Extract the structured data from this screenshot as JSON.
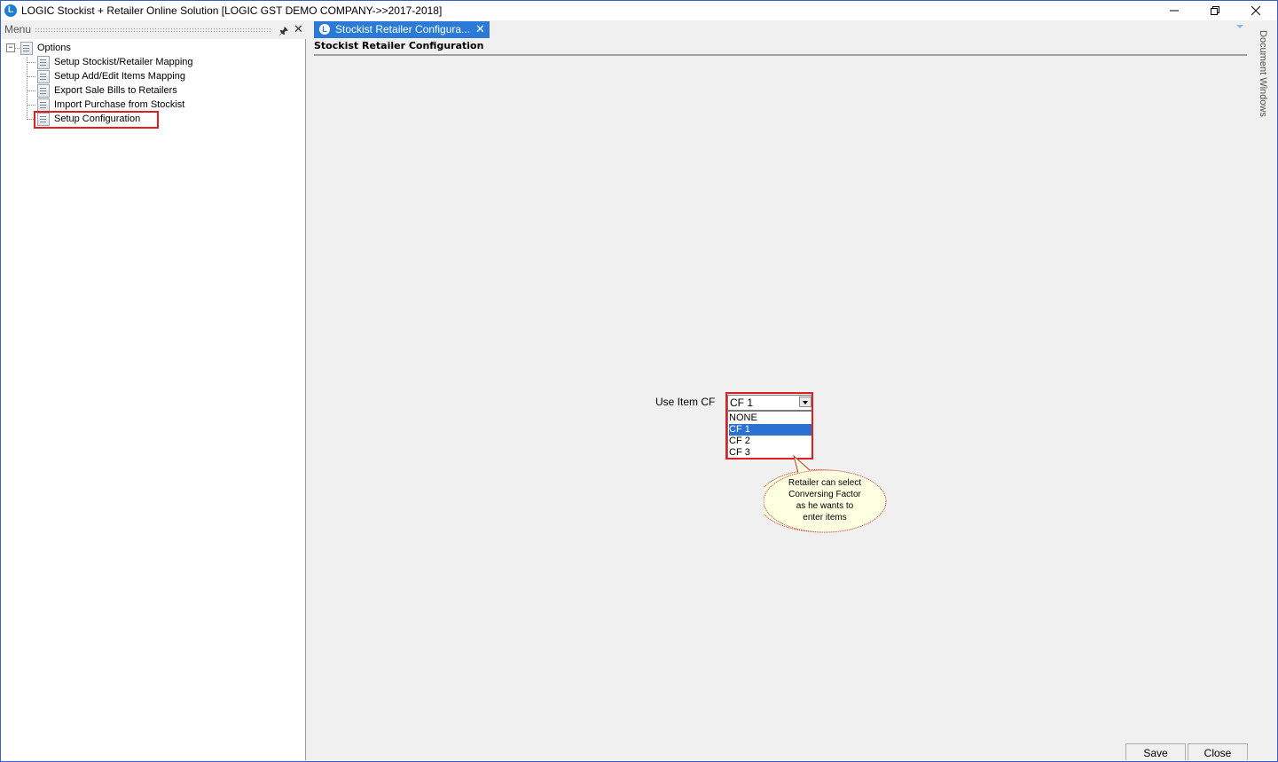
{
  "window": {
    "title": "LOGIC Stockist + Retailer Online Solution [LOGIC GST DEMO COMPANY->>2017-2018]",
    "app_icon_letter": "L"
  },
  "menu": {
    "title": "Menu",
    "root": "Options",
    "items": [
      "Setup Stockist/Retailer Mapping",
      "Setup Add/Edit Items Mapping",
      "Export Sale Bills to Retailers",
      "Import Purchase from Stockist",
      "Setup Configuration"
    ],
    "highlighted_item": "Setup Configuration"
  },
  "tabs": [
    {
      "label": "Stockist Retailer Configura...",
      "active": true
    }
  ],
  "form": {
    "title": "Stockist Retailer Configuration",
    "use_item_cf_label": "Use Item CF",
    "use_item_cf_value": "CF 1",
    "options": [
      "NONE",
      "CF 1",
      "CF 2",
      "CF 3"
    ],
    "selected_option": "CF 1"
  },
  "callout": {
    "lines": [
      "Retailer can select",
      "Conversing Factor",
      "as he wants to",
      "enter items"
    ]
  },
  "side_panel": {
    "label": "Document Windows"
  },
  "buttons": {
    "save": "Save",
    "close": "Close"
  },
  "colors": {
    "accent": "#2b7bd6",
    "highlight_border": "#e02020",
    "callout_fill": "#ffffe1",
    "selection": "#2b72d0"
  }
}
